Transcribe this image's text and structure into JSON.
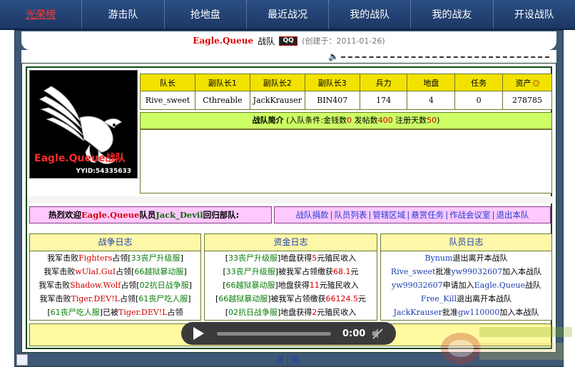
{
  "nav": [
    {
      "label": "光荣榜",
      "active": true
    },
    {
      "label": "游击队",
      "active": false
    },
    {
      "label": "抢地盘",
      "active": false
    },
    {
      "label": "最近战况",
      "active": false
    },
    {
      "label": "我的战队",
      "active": false
    },
    {
      "label": "我的战友",
      "active": false
    },
    {
      "label": "开设战队",
      "active": false
    }
  ],
  "title": {
    "team_name": "Eagle.Queue",
    "suffix": "战队",
    "badge": "QQ",
    "created": "(创建于：2011-01-26)"
  },
  "logo": {
    "title": "Eagle.Queue战队",
    "yyid": "YYID:54335633"
  },
  "officers": {
    "headers": [
      "队长",
      "副队长1",
      "副队长2",
      "副队长3",
      "兵力",
      "地盘",
      "任务",
      "资产"
    ],
    "values": [
      "Rive_sweet",
      "Cthreable",
      "JackKrauser",
      "BIN407",
      "174",
      "4",
      "0",
      "278785"
    ]
  },
  "intro": {
    "label": "战队简介",
    "cond_prefix": "(入队条件:金钱数",
    "money": "0",
    "posts_label": "发帖数",
    "posts": "400",
    "days_label": "注册天数",
    "days": "50",
    "cond_suffix": ")"
  },
  "welcome": {
    "prefix": "热烈欢迎",
    "team": "Eagle.Queue",
    "mid": "队员",
    "member": "Jack_Devil",
    "suffix": "回归部队:"
  },
  "links": [
    "战队捐款",
    "队员列表",
    "管辖区域",
    "悬赏任务",
    "作战会议室",
    "退出本队"
  ],
  "war_log": {
    "title": "战争日志",
    "rows": [
      {
        "a": "我军击败",
        "b": "Fighters",
        "c": "占领[",
        "d": "33丧尸升级服",
        "e": "]"
      },
      {
        "a": "我军击败",
        "b": "wUlaI.GuI",
        "c": "占领[",
        "d": "66越狱暴动服",
        "e": "]"
      },
      {
        "a": "我军击败",
        "b": "Shadow.Wolf",
        "c": "占领[",
        "d": "02抗日战争服",
        "e": "]"
      },
      {
        "a": "我军击败",
        "b": "Tiger.DEV!L",
        "c": "占领[",
        "d": "61丧尸吃人服",
        "e": "]"
      },
      {
        "a": "[",
        "b": "61丧尸吃人服",
        "c": "]已被",
        "d": "Tiger.DEV!L",
        "e": "占领"
      }
    ]
  },
  "fund_log": {
    "title": "资金日志",
    "rows": [
      {
        "a": "[",
        "b": "33丧尸升级服",
        "c": "]地盘获得",
        "d": "5",
        "e": "元殖民收入"
      },
      {
        "a": "[",
        "b": "33丧尸升级服",
        "c": "]被我军占领缴获",
        "d": "68.1",
        "e": "元"
      },
      {
        "a": "[",
        "b": "66越狱暴动服",
        "c": "]地盘获得",
        "d": "11",
        "e": "元殖民收入"
      },
      {
        "a": "[",
        "b": "66越狱暴动服",
        "c": "]被我军占领缴获",
        "d": "66124.5",
        "e": "元"
      },
      {
        "a": "[",
        "b": "02抗日战争服",
        "c": "]地盘获得",
        "d": "2",
        "e": "元殖民收入"
      }
    ]
  },
  "member_log": {
    "title": "队员日志",
    "rows": [
      {
        "a": "Bynum",
        "b": "退出离开本战队",
        "c": "",
        "d": ""
      },
      {
        "a": "Rive_sweet",
        "b": "批准",
        "c": "yw99032607",
        "d": "加入本战队"
      },
      {
        "a": "yw99032607",
        "b": "申请加入",
        "c": "Eagle.Queue",
        "d": "战队"
      },
      {
        "a": "Free_Kill",
        "b": "退出离开本战队",
        "c": "",
        "d": ""
      },
      {
        "a": "JackKrauser",
        "b": "批准",
        "c": "gw110000",
        "d": "加入本战队"
      }
    ]
  },
  "player": {
    "time": "0:00"
  },
  "pager": {
    "first": "首",
    "last": "尾"
  },
  "colors": {
    "nav_bg": "#2b4f82",
    "frame": "#3e5876",
    "header_yellow": "#f2e200",
    "intro_green": "#ccff66",
    "pink": "#ffc8ff",
    "red": "#d40000",
    "green": "#0b7d0b",
    "blue": "#1c3fb0"
  }
}
